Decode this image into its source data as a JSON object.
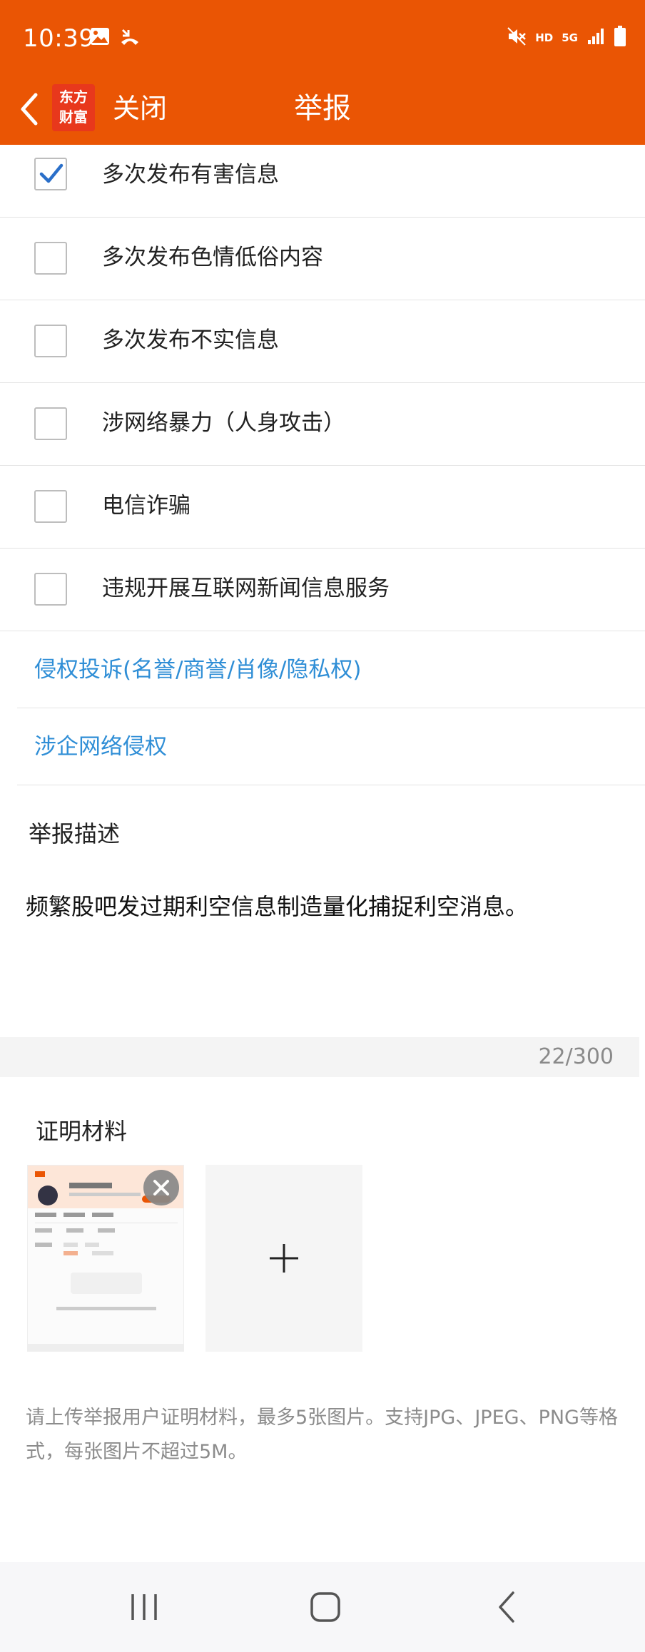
{
  "status": {
    "time": "10:39",
    "icons": [
      "image-icon",
      "missed-call-icon",
      "mute-icon",
      "hd-icon",
      "5g-icon",
      "signal-icon",
      "battery-icon"
    ],
    "hd": "HD",
    "net": "5G"
  },
  "header": {
    "logo_line1": "东方",
    "logo_line2": "财富",
    "close_label": "关闭",
    "title": "举报"
  },
  "options": [
    {
      "label": "多次发布有害信息",
      "checked": true
    },
    {
      "label": "多次发布色情低俗内容",
      "checked": false
    },
    {
      "label": "多次发布不实信息",
      "checked": false
    },
    {
      "label": "涉网络暴力（人身攻击）",
      "checked": false
    },
    {
      "label": "电信诈骗",
      "checked": false
    },
    {
      "label": "违规开展互联网新闻信息服务",
      "checked": false
    }
  ],
  "links": [
    {
      "label": "侵权投诉(名誉/商誉/肖像/隐私权)"
    },
    {
      "label": "涉企网络侵权"
    }
  ],
  "description": {
    "title": "举报描述",
    "value": "频繁股吧发过期利空信息制造量化捕捉利空消息。",
    "counter": "22/300"
  },
  "evidence": {
    "title": "证明材料",
    "hint": "请上传举报用户证明材料，最多5张图片。支持JPG、JPEG、PNG等格式，每张图片不超过5M。"
  },
  "colors": {
    "brand": "#ea5504",
    "link": "#2f8ed6",
    "check": "#2a6fc9"
  }
}
